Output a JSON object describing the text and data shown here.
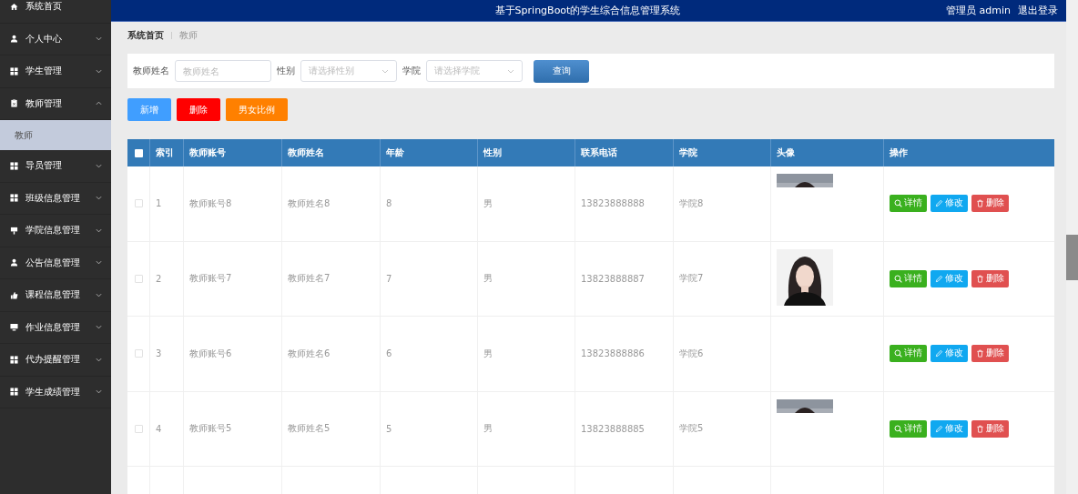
{
  "sidebar": {
    "items": [
      {
        "label": "系统首页",
        "kind": "home"
      },
      {
        "label": "个人中心",
        "kind": "user",
        "expanded": false
      },
      {
        "label": "学生管理",
        "kind": "grid",
        "expanded": false
      },
      {
        "label": "教师管理",
        "kind": "clipboard",
        "expanded": true,
        "children": [
          {
            "label": "教师",
            "selected": true
          }
        ]
      },
      {
        "label": "导员管理",
        "kind": "grid",
        "expanded": false
      },
      {
        "label": "班级信息管理",
        "kind": "grid",
        "expanded": false
      },
      {
        "label": "学院信息管理",
        "kind": "sign",
        "expanded": false
      },
      {
        "label": "公告信息管理",
        "kind": "user",
        "expanded": false
      },
      {
        "label": "课程信息管理",
        "kind": "hand",
        "expanded": false
      },
      {
        "label": "作业信息管理",
        "kind": "monitor",
        "expanded": false
      },
      {
        "label": "代办提醒管理",
        "kind": "grid",
        "expanded": false
      },
      {
        "label": "学生成绩管理",
        "kind": "grid",
        "expanded": false
      }
    ]
  },
  "header": {
    "title": "基于SpringBoot的学生综合信息管理系统",
    "user": "管理员 admin",
    "logout": "退出登录"
  },
  "breadcrumb": [
    "系统首页",
    "教师"
  ],
  "search": {
    "fields": [
      {
        "label": "教师姓名",
        "kind": "text",
        "placeholder": "教师姓名"
      },
      {
        "label": "性别",
        "kind": "select",
        "placeholder": "请选择性别"
      },
      {
        "label": "学院",
        "kind": "select",
        "placeholder": "请选择学院"
      }
    ],
    "button": "查询"
  },
  "actions": [
    {
      "label": "新增",
      "color": "#409eff"
    },
    {
      "label": "删除",
      "color": "#ff0000"
    },
    {
      "label": "男女比例",
      "color": "#ff8000"
    }
  ],
  "table": {
    "select_all": {
      "checked": false
    },
    "columns": [
      "索引",
      "教师账号",
      "教师姓名",
      "年龄",
      "性别",
      "联系电话",
      "学院",
      "头像",
      "操作"
    ],
    "rows": [
      {
        "checked": false,
        "cells": [
          "1",
          "教师账号8",
          "教师姓名8",
          "8",
          "男",
          "13823888888",
          "学院8"
        ],
        "photo": {
          "kind": "strip"
        },
        "actions": [
          "详情",
          "修改",
          "删除"
        ]
      },
      {
        "checked": false,
        "cells": [
          "2",
          "教师账号7",
          "教师姓名7",
          "7",
          "男",
          "13823888887",
          "学院7"
        ],
        "photo": {
          "kind": "picture"
        },
        "actions": [
          "详情",
          "修改",
          "删除"
        ]
      },
      {
        "checked": false,
        "cells": [
          "3",
          "教师账号6",
          "教师姓名6",
          "6",
          "男",
          "13823888886",
          "学院6"
        ],
        "actions": [
          "详情",
          "修改",
          "删除"
        ]
      },
      {
        "checked": false,
        "cells": [
          "4",
          "教师账号5",
          "教师姓名5",
          "5",
          "男",
          "13823888885",
          "学院5"
        ],
        "photo": {
          "kind": "strip"
        },
        "actions": [
          "详情",
          "修改",
          "删除"
        ]
      }
    ]
  }
}
